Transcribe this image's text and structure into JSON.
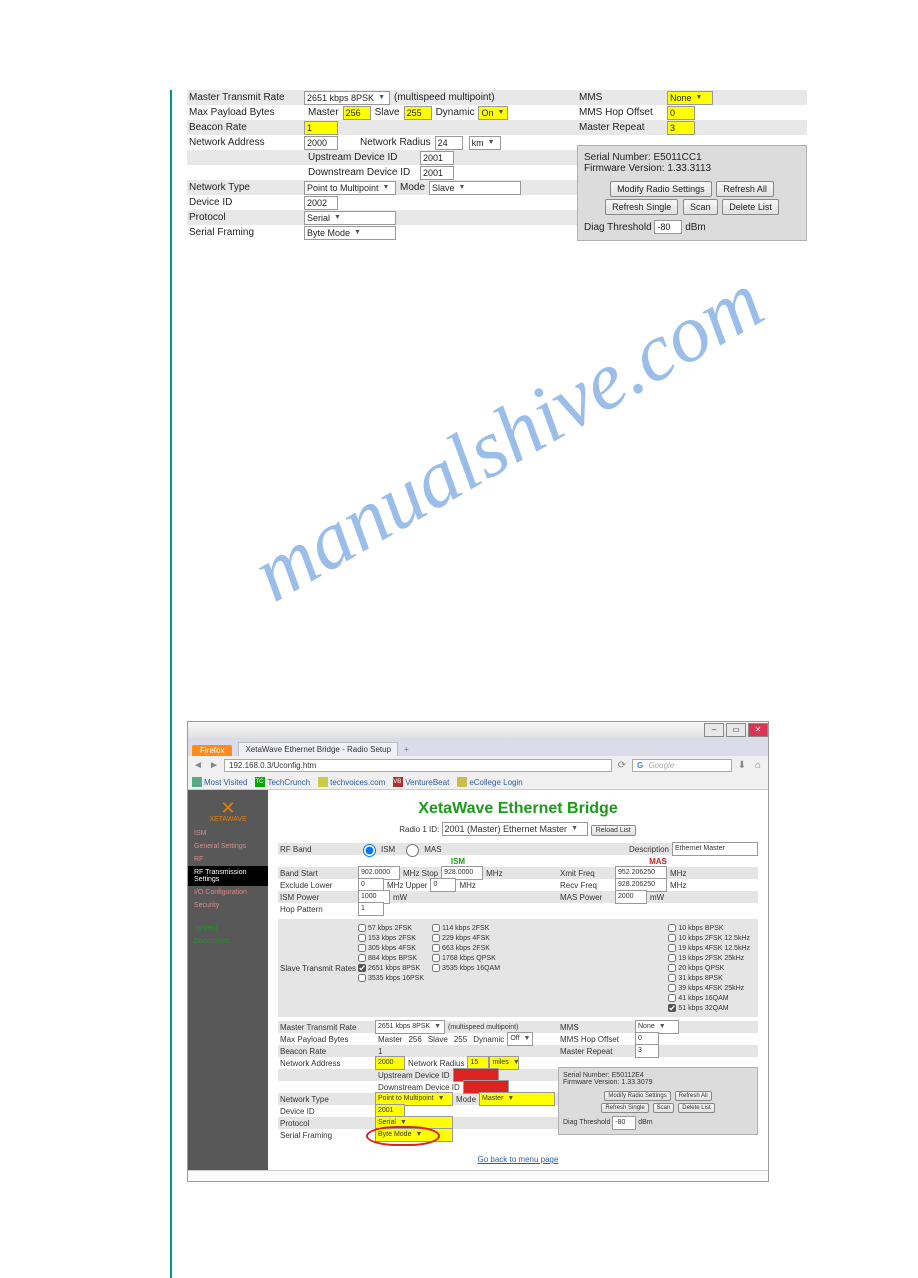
{
  "watermark": "manualshive.com",
  "crop1": {
    "master_transmit_rate_label": "Master Transmit Rate",
    "master_transmit_rate_value": "2651 kbps 8PSK",
    "multispeed_note": "(multispeed multipoint)",
    "max_payload_label": "Max Payload Bytes",
    "master_label": "Master",
    "master_val": "256",
    "slave_label": "Slave",
    "slave_val": "255",
    "dynamic_label": "Dynamic",
    "dynamic_val": "On",
    "beacon_rate_label": "Beacon Rate",
    "beacon_rate_val": "1",
    "network_address_label": "Network Address",
    "network_address_val": "2000",
    "network_radius_label": "Network Radius",
    "network_radius_val": "24",
    "network_radius_unit": "km",
    "upstream_label": "Upstream Device ID",
    "upstream_val": "2001",
    "downstream_label": "Downstream Device ID",
    "downstream_val": "2001",
    "network_type_label": "Network Type",
    "network_type_val": "Point to Multipoint",
    "mode_label": "Mode",
    "mode_val": "Slave",
    "device_id_label": "Device ID",
    "device_id_val": "2002",
    "protocol_label": "Protocol",
    "protocol_val": "Serial",
    "serial_framing_label": "Serial Framing",
    "serial_framing_val": "Byte Mode",
    "right": {
      "mms_label": "MMS",
      "mms_val": "None",
      "mms_hop_label": "MMS Hop Offset",
      "mms_hop_val": "0",
      "master_repeat_label": "Master Repeat",
      "master_repeat_val": "3",
      "serial_label": "Serial Number:",
      "serial_val": "E5011CC1",
      "firmware_label": "Firmware Version:",
      "firmware_val": "1.33.3113",
      "btn_modify": "Modify Radio Settings",
      "btn_refresh_all": "Refresh All",
      "btn_refresh_single": "Refresh Single",
      "btn_scan": "Scan",
      "btn_delete_list": "Delete List",
      "diag_label": "Diag Threshold",
      "diag_val": "-80",
      "diag_unit": "dBm"
    }
  },
  "browser": {
    "firefox_label": "Firefox",
    "tab_title": "XetaWave Ethernet Bridge - Radio Setup",
    "url": "192.168.0.3/Uconfig.htm",
    "search_placeholder": "Google",
    "bookmarks": {
      "most_visited": "Most Visited",
      "tc": "TechCrunch",
      "tv": "techvoices.com",
      "vb": "VentureBeat",
      "ec": "eCollege Login"
    },
    "sidebar": {
      "brand": "XETAWAVE",
      "items": [
        "ISM",
        "General Settings",
        "RF",
        "RF Transmission Settings",
        "I/O Configuration",
        "Security",
        "System",
        "Documents"
      ]
    },
    "page": {
      "title": "XetaWave Ethernet Bridge",
      "radio_select_prefix": "Radio 1 ID:",
      "radio_select_val": "2001 (Master) Ethernet Master",
      "reload_btn": "Reload List",
      "rf_band_label": "RF Band",
      "rf_band_ism": "ISM",
      "rf_band_mas": "MAS",
      "description_label": "Description",
      "description_val": "Ethernet Master",
      "ism_head": "ISM",
      "mas_head": "MAS",
      "band_start_label": "Band Start",
      "band_start_val": "902.0000",
      "mhz_stop_label": "MHz Stop",
      "mhz_stop_val": "928.0000",
      "mhz_unit": "MHz",
      "xmit_freq_label": "Xmit Freq",
      "xmit_freq_val": "952.206250",
      "exclude_lower_label": "Exclude Lower",
      "exclude_lower_val": "0",
      "mhz_upper_label": "MHz Upper",
      "mhz_upper_val": "0",
      "recv_freq_label": "Recv Freq",
      "recv_freq_val": "928.206250",
      "ism_power_label": "ISM Power",
      "ism_power_val": "1000",
      "mw_unit": "mW",
      "mas_power_label": "MAS Power",
      "mas_power_val": "2000",
      "hop_pattern_label": "Hop Pattern",
      "hop_pattern_val": "1",
      "slave_transmit_label": "Slave Transmit Rates",
      "rates_col1": [
        "57 kbps 2FSK",
        "153 kbps 2FSK",
        "305 kbps 4FSK",
        "884 kbps BPSK",
        "2651 kbps 8PSK",
        "3535 kbps 16PSK"
      ],
      "rates_col2": [
        "114 kbps 2FSK",
        "229 kbps 4FSK",
        "663 kbps 2FSK",
        "1768 kbps QPSK",
        "3535 kbps 16QAM"
      ],
      "rates_mas": [
        "10 kbps BPSK",
        "10 kbps 2FSK 12.5kHz",
        "19 kbps 4FSK 12.5kHz",
        "19 kbps 2FSK 25kHz",
        "20 kbps QPSK",
        "31 kbps 8PSK",
        "39 kbps 4FSK 25kHz",
        "41 kbps 16QAM",
        "51 kbps 32QAM"
      ],
      "master_transmit_rate_label": "Master Transmit Rate",
      "master_transmit_rate_val": "2651 kbps 8PSK",
      "multispeed_note": "(multispeed multipoint)",
      "max_payload_label": "Max Payload Bytes",
      "master_label": "Master",
      "master_val": "256",
      "slave_label": "Slave",
      "slave_val": "255",
      "dynamic_label": "Dynamic",
      "dynamic_val": "Off",
      "beacon_rate_label": "Beacon Rate",
      "beacon_rate_val": "1",
      "network_address_label": "Network Address",
      "network_address_val": "2000",
      "network_radius_label": "Network Radius",
      "network_radius_val": "15",
      "network_radius_unit": "miles",
      "upstream_label": "Upstream Device ID",
      "downstream_label": "Downstream Device ID",
      "network_type_label": "Network Type",
      "network_type_val": "Point to Multipoint",
      "mode_label": "Mode",
      "mode_val": "Master",
      "device_id_label": "Device ID",
      "device_id_val": "2001",
      "protocol_label": "Protocol",
      "protocol_val": "Serial",
      "serial_framing_label": "Serial Framing",
      "serial_framing_val": "Byte Mode",
      "mms_label": "MMS",
      "mms_val": "None",
      "mms_hop_label": "MMS Hop Offset",
      "mms_hop_val": "0",
      "master_repeat_label": "Master Repeat",
      "master_repeat_val": "3",
      "serial_label": "Serial Number:",
      "serial_val": "E50112E4",
      "firmware_label": "Firmware Version:",
      "firmware_val": "1.33.3079",
      "btn_modify": "Modify Radio Settings",
      "btn_refresh_all": "Refresh All",
      "btn_refresh_single": "Refresh Single",
      "btn_scan": "Scan",
      "btn_delete_list": "Delete List",
      "diag_label": "Diag Threshold",
      "diag_val": "-80",
      "diag_unit": "dBm",
      "goback": "Go back to menu page"
    }
  }
}
